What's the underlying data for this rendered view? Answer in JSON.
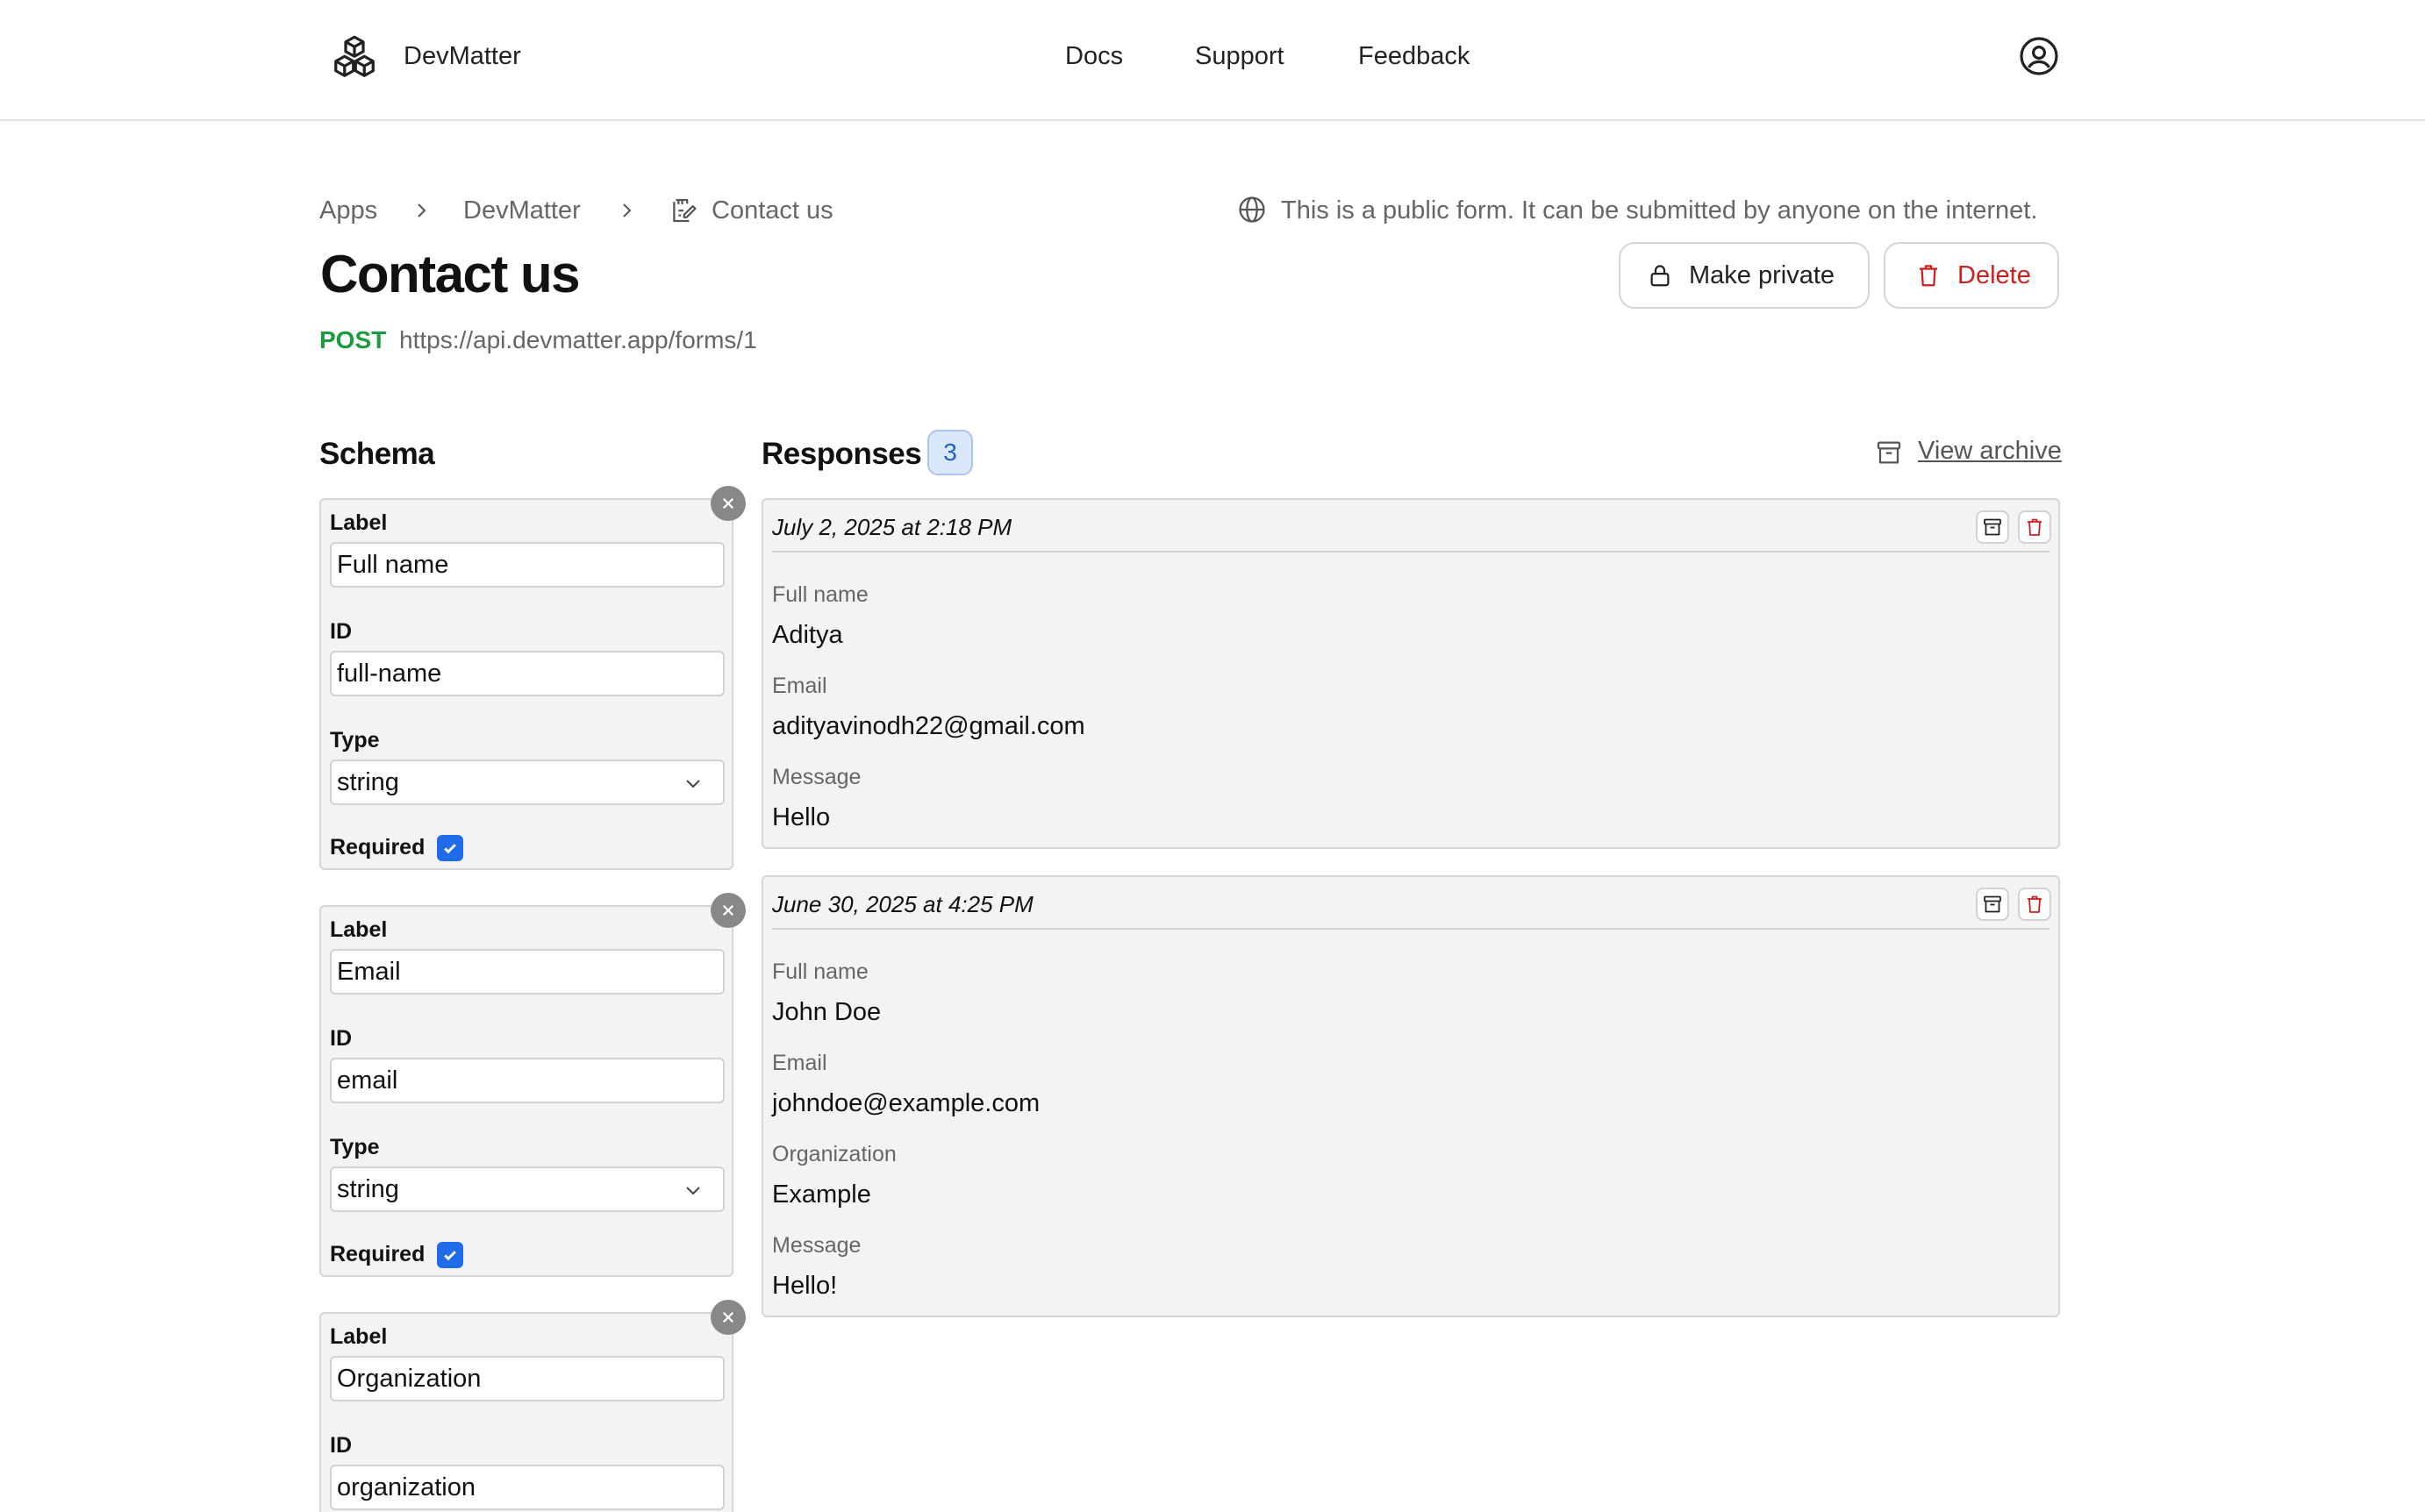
{
  "header": {
    "brand": "DevMatter",
    "nav": [
      "Docs",
      "Support",
      "Feedback"
    ]
  },
  "breadcrumb": [
    "Apps",
    "DevMatter",
    "Contact us"
  ],
  "public_note": "This is a public form. It can be submitted by anyone on the internet.",
  "page": {
    "title": "Contact us",
    "method": "POST",
    "endpoint": "https://api.devmatter.app/forms/1",
    "make_private_label": "Make private",
    "delete_label": "Delete"
  },
  "schema": {
    "title": "Schema",
    "label_caption": "Label",
    "id_caption": "ID",
    "type_caption": "Type",
    "required_caption": "Required",
    "fields": [
      {
        "label": "Full name",
        "id": "full-name",
        "type": "string",
        "required": true
      },
      {
        "label": "Email",
        "id": "email",
        "type": "string",
        "required": true
      },
      {
        "label": "Organization",
        "id": "organization"
      }
    ]
  },
  "responses": {
    "title": "Responses",
    "count": "3",
    "view_archive": "View archive",
    "items": [
      {
        "date": "July 2, 2025 at 2:18 PM",
        "fields": [
          {
            "key": "Full name",
            "value": "Aditya"
          },
          {
            "key": "Email",
            "value": "adityavinodh22@gmail.com"
          },
          {
            "key": "Message",
            "value": "Hello"
          }
        ]
      },
      {
        "date": "June 30, 2025 at 4:25 PM",
        "fields": [
          {
            "key": "Full name",
            "value": "John Doe"
          },
          {
            "key": "Email",
            "value": "johndoe@example.com"
          },
          {
            "key": "Organization",
            "value": "Example"
          },
          {
            "key": "Message",
            "value": "Hello!"
          }
        ]
      }
    ]
  },
  "colors": {
    "accent_blue": "#1f6be8",
    "method_green": "#1a9c3e",
    "danger_red": "#cc1f1f"
  },
  "icons": [
    "cubes-logo-icon",
    "user-circle-icon",
    "chevron-right-icon",
    "form-edit-icon",
    "globe-icon",
    "lock-icon",
    "trash-icon",
    "archive-icon",
    "close-icon",
    "chevron-down-icon",
    "check-icon"
  ]
}
